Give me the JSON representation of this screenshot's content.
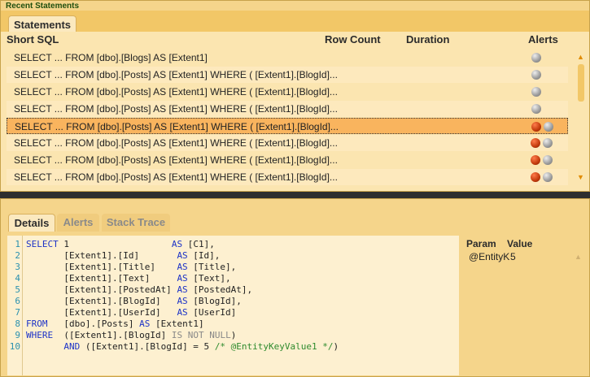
{
  "top": {
    "title": "Recent Statements",
    "tab": "Statements",
    "headers": {
      "sql": "Short SQL",
      "rows": "Row Count",
      "duration": "Duration",
      "alerts": "Alerts"
    },
    "rows": [
      {
        "sql": "SELECT ... FROM [dbo].[Blogs] AS [Extent1]",
        "alerts": [
          "gray"
        ]
      },
      {
        "sql": "SELECT ... FROM [dbo].[Posts] AS [Extent1] WHERE ( [Extent1].[BlogId]...",
        "alerts": [
          "gray"
        ]
      },
      {
        "sql": "SELECT ... FROM [dbo].[Posts] AS [Extent1] WHERE ( [Extent1].[BlogId]...",
        "alerts": [
          "gray"
        ]
      },
      {
        "sql": "SELECT ... FROM [dbo].[Posts] AS [Extent1] WHERE ( [Extent1].[BlogId]...",
        "alerts": [
          "gray"
        ]
      },
      {
        "sql": "SELECT ... FROM [dbo].[Posts] AS [Extent1] WHERE ( [Extent1].[BlogId]...",
        "alerts": [
          "red",
          "gray"
        ],
        "selected": true
      },
      {
        "sql": "SELECT ... FROM [dbo].[Posts] AS [Extent1] WHERE ( [Extent1].[BlogId]...",
        "alerts": [
          "red",
          "gray"
        ]
      },
      {
        "sql": "SELECT ... FROM [dbo].[Posts] AS [Extent1] WHERE ( [Extent1].[BlogId]...",
        "alerts": [
          "red",
          "gray"
        ]
      },
      {
        "sql": "SELECT ... FROM [dbo].[Posts] AS [Extent1] WHERE ( [Extent1].[BlogId]...",
        "alerts": [
          "red",
          "gray"
        ]
      }
    ]
  },
  "bottom": {
    "tabs": [
      "Details",
      "Alerts",
      "Stack Trace"
    ],
    "active_tab": "Details",
    "code_lines": [
      "SELECT 1                   AS [C1],",
      "       [Extent1].[Id]       AS [Id],",
      "       [Extent1].[Title]    AS [Title],",
      "       [Extent1].[Text]     AS [Text],",
      "       [Extent1].[PostedAt] AS [PostedAt],",
      "       [Extent1].[BlogId]   AS [BlogId],",
      "       [Extent1].[UserId]   AS [UserId]",
      "FROM   [dbo].[Posts] AS [Extent1]",
      "WHERE  ([Extent1].[BlogId] IS NOT NULL)",
      "       AND ([Extent1].[BlogId] = 5 /* @EntityKeyValue1 */)"
    ],
    "params": {
      "header_param": "Param",
      "header_value": "Value",
      "name": "@EntityK",
      "value": "5"
    }
  },
  "colors": {
    "panel": "#f5d58b",
    "selected_row": "#f9b45e",
    "alert_red": "#c23a0c",
    "alert_gray": "#9a9a9a"
  },
  "icons": [
    "alert-gray-icon",
    "alert-red-icon",
    "scroll-up-icon",
    "scroll-down-icon"
  ]
}
